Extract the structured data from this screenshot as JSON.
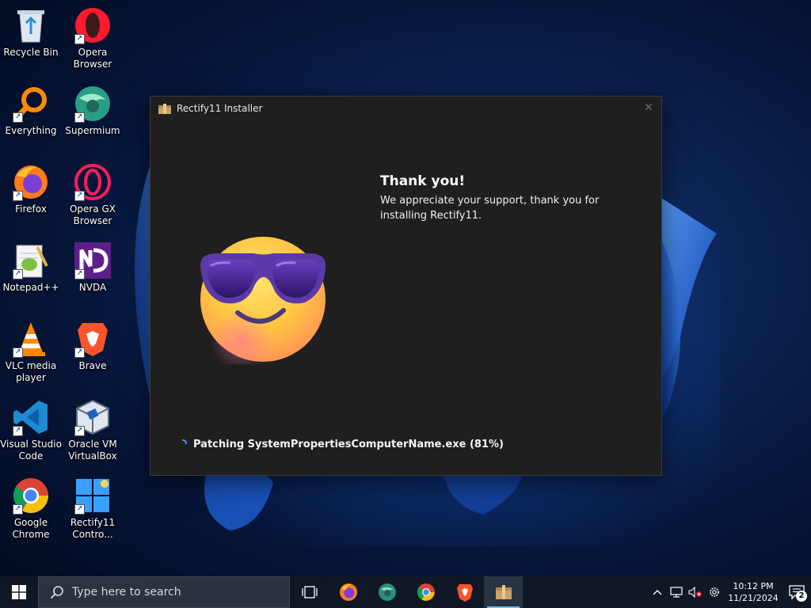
{
  "desktop": {
    "icons": [
      {
        "label": "Recycle Bin",
        "icon": "recycle-bin-icon"
      },
      {
        "label": "Opera\nBrowser",
        "icon": "opera-icon"
      },
      {
        "label": "Everything",
        "icon": "everything-search-icon"
      },
      {
        "label": "Supermium",
        "icon": "supermium-icon"
      },
      {
        "label": "Firefox",
        "icon": "firefox-icon"
      },
      {
        "label": "Opera GX\nBrowser",
        "icon": "opera-gx-icon"
      },
      {
        "label": "Notepad++",
        "icon": "notepad-plus-plus-icon"
      },
      {
        "label": "NVDA",
        "icon": "nvda-icon"
      },
      {
        "label": "VLC media\nplayer",
        "icon": "vlc-icon"
      },
      {
        "label": "Brave",
        "icon": "brave-icon"
      },
      {
        "label": "Visual Studio\nCode",
        "icon": "vscode-icon"
      },
      {
        "label": "Oracle VM\nVirtualBox",
        "icon": "virtualbox-icon"
      },
      {
        "label": "Google\nChrome",
        "icon": "chrome-icon"
      },
      {
        "label": "Rectify11\nContro...",
        "icon": "rectify11-control-panel-icon"
      }
    ]
  },
  "installer": {
    "title": "Rectify11 Installer",
    "heading": "Thank you!",
    "message": "We appreciate your support, thank you for installing Rectify11.",
    "status": "Patching SystemPropertiesComputerName.exe (81%)",
    "close_glyph": "✕"
  },
  "taskbar": {
    "search_placeholder": "Type here to search",
    "apps": [
      "task-view-icon",
      "firefox-icon",
      "supermium-icon",
      "chrome-icon",
      "brave-icon",
      "installer-icon"
    ],
    "time": "10:12 PM",
    "date": "11/21/2024",
    "notification_count": "2"
  },
  "colors": {
    "accent": "#76b9ed",
    "window_bg": "#1f1f1f",
    "taskbar_bg": "#101826"
  }
}
